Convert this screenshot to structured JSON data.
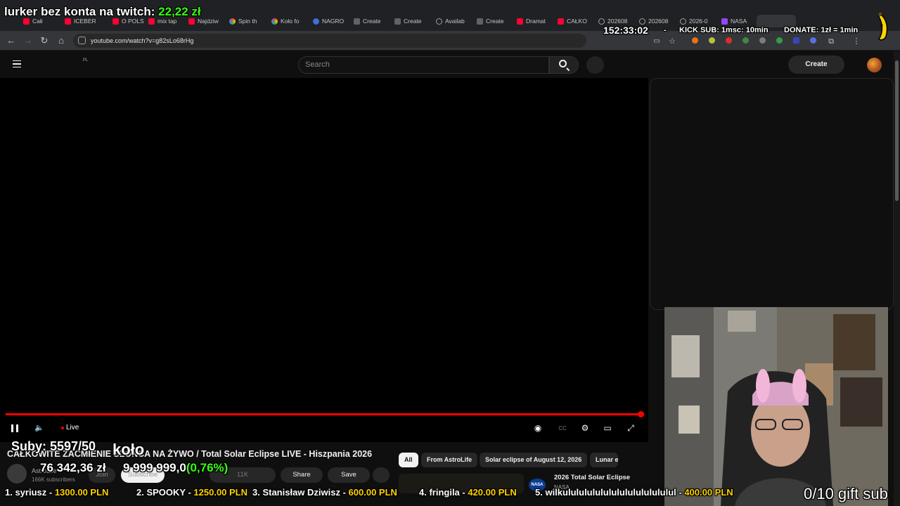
{
  "browser": {
    "tabs": [
      {
        "label": "Całi",
        "icon": "youtube-icon"
      },
      {
        "label": "ICEBER",
        "icon": "youtube-icon"
      },
      {
        "label": "O POLS",
        "icon": "youtube-icon"
      },
      {
        "label": "mix tap",
        "icon": "youtube-icon"
      },
      {
        "label": "Najdziw",
        "icon": "youtube-icon"
      },
      {
        "label": "Spin th",
        "icon": "color-wheel-icon"
      },
      {
        "label": "Koło fo",
        "icon": "color-wheel-icon"
      },
      {
        "label": "NAGRO",
        "icon": "blue-circle-icon"
      },
      {
        "label": "Create",
        "icon": "doc-icon"
      },
      {
        "label": "Create",
        "icon": "doc-icon"
      },
      {
        "label": "Availab",
        "icon": "globe-icon"
      },
      {
        "label": "Create",
        "icon": "doc-icon"
      },
      {
        "label": "Dramat",
        "icon": "youtube-icon"
      },
      {
        "label": "CAŁKO",
        "icon": "youtube-icon"
      },
      {
        "label": "202608",
        "icon": "globe-icon"
      },
      {
        "label": "202608",
        "icon": "globe-icon"
      },
      {
        "label": "2026-0",
        "icon": "globe-icon"
      },
      {
        "label": "NASA",
        "icon": "twitch-icon"
      }
    ],
    "url": "youtube.com/watch?v=g82sLo68rHg"
  },
  "overlay_top": {
    "lurker_label": "lurker bez konta na twitch:",
    "lurker_amount": "22,22 zł",
    "timer": "152:33:02",
    "separator": "-",
    "kick_sub": "KICK SUB: 1msc: 10min",
    "donate": "DONATE: 1zł = 1min"
  },
  "youtube_header": {
    "region": "PL",
    "search_placeholder": "Search",
    "create_label": "Create"
  },
  "player": {
    "progress_fraction": 0.995,
    "live_label": "Live",
    "colors": {
      "progress": "#ff0000"
    }
  },
  "video": {
    "title": "CAŁKOWITE ZAĆMIENIE SŁOŃCA NA ŻYWO / Total Solar Eclipse LIVE - Hiszpania 2026",
    "channel_name": "AstroLife",
    "channel_subs": "166K subscribers",
    "join_label": "Join",
    "subscribe_label": "Subscribe",
    "like_count": "11K",
    "share_label": "Share",
    "save_label": "Save"
  },
  "chips": [
    "All",
    "From AstroLife",
    "Solar eclipse of August 12, 2026",
    "Lunar e"
  ],
  "recommendation": {
    "title": "2026 Total Solar Eclipse",
    "channel": "NASA",
    "logo_text": "NASA"
  },
  "stream_overlay": {
    "suby": "Suby: 5597/50",
    "kolo": "koło",
    "money_amount": "76 342,36 zł",
    "goal": "9 999 999,0",
    "goal_pct": "(0,76%)",
    "gift_sub": "0/10 gift sub",
    "top_donors": [
      {
        "rank_name": "1. syriusz - ",
        "amount": "1300.00 PLN"
      },
      {
        "rank_name": "2. SPOOKY - ",
        "amount": "1250.00 PLN"
      },
      {
        "rank_name": "3. Stanisław Dziwisz - ",
        "amount": "600.00 PLN"
      },
      {
        "rank_name": "4. fringila - ",
        "amount": "420.00 PLN"
      },
      {
        "rank_name": "5. wilkulululululululululululululul - ",
        "amount": "400.00 PLN"
      }
    ]
  }
}
